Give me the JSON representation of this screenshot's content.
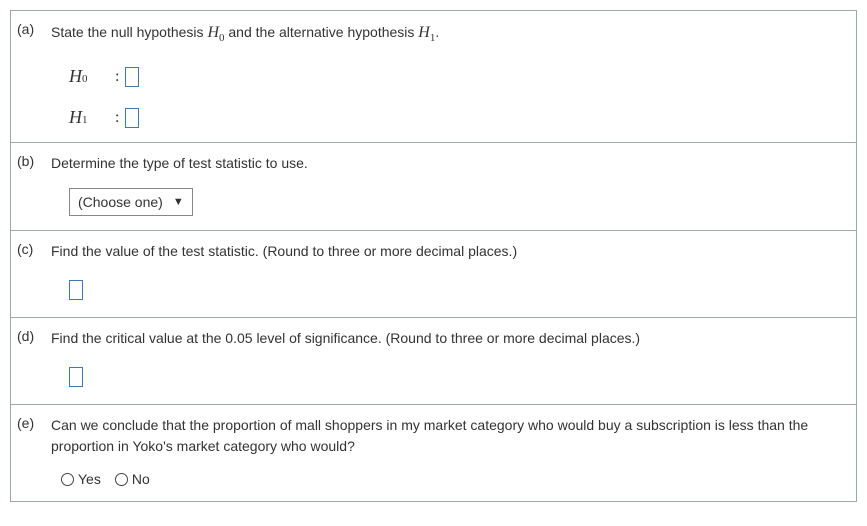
{
  "parts": {
    "a": {
      "label": "(a)",
      "text_before": "State the null hypothesis ",
      "h0_symbol": "H",
      "h0_sub": "0",
      "text_mid": " and the alternative hypothesis ",
      "h1_symbol": "H",
      "h1_sub": "1",
      "text_after": ".",
      "row1_symbol": "H",
      "row1_sub": "0",
      "row2_symbol": "H",
      "row2_sub": "1",
      "colon": ":"
    },
    "b": {
      "label": "(b)",
      "text": "Determine the type of test statistic to use.",
      "select_placeholder": "(Choose one)"
    },
    "c": {
      "label": "(c)",
      "text": "Find the value of the test statistic. (Round to three or more decimal places.)"
    },
    "d": {
      "label": "(d)",
      "text": "Find the critical value at the 0.05 level of significance. (Round to three or more decimal places.)"
    },
    "e": {
      "label": "(e)",
      "text": "Can we conclude that the proportion of mall shoppers in my market category who would buy a subscription is less than the proportion in Yoko's market category who would?",
      "opt_yes": "Yes",
      "opt_no": "No"
    }
  }
}
